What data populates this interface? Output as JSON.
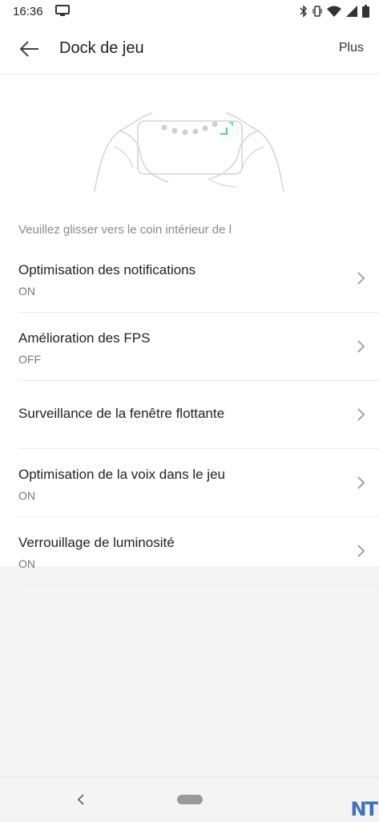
{
  "status_bar": {
    "time": "16:36",
    "icons": [
      "tv-icon",
      "bluetooth-icon",
      "vibrate-icon",
      "wifi-icon",
      "signal-icon",
      "battery-icon"
    ]
  },
  "header": {
    "back_icon": "arrow-left-icon",
    "title": "Dock de jeu",
    "more_label": "Plus"
  },
  "illustration": {
    "icon": "hands-holding-phone-illustration",
    "accent_color": "#3ddc6a"
  },
  "hint": "Veuillez glisser vers le coin intérieur de l",
  "settings": [
    {
      "title": "Optimisation des notifications",
      "value": "ON"
    },
    {
      "title": "Amélioration des FPS",
      "value": "OFF"
    },
    {
      "title": "Surveillance de la fenêtre flottante"
    },
    {
      "title": "Optimisation de la voix dans le jeu",
      "value": "ON"
    },
    {
      "title": "Verrouillage de luminosité",
      "value": "ON"
    }
  ],
  "nav_bar": {
    "back_icon": "chevron-left-icon",
    "home_icon": "home-pill-icon"
  },
  "watermark": "NT"
}
